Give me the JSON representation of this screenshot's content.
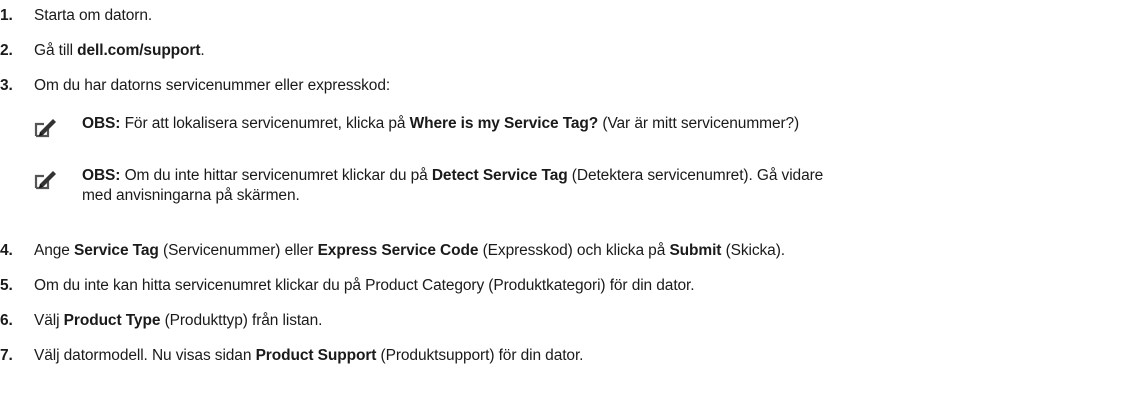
{
  "steps": [
    {
      "num": "1.",
      "parts": [
        {
          "t": "Starta om datorn.",
          "b": false
        }
      ]
    },
    {
      "num": "2.",
      "parts": [
        {
          "t": "Gå till ",
          "b": false
        },
        {
          "t": "dell.com/support",
          "b": true
        },
        {
          "t": ".",
          "b": false
        }
      ]
    },
    {
      "num": "3.",
      "parts": [
        {
          "t": "Om du har datorns servicenummer eller expresskod:",
          "b": false
        }
      ]
    },
    {
      "num": "4.",
      "parts": [
        {
          "t": "Ange ",
          "b": false
        },
        {
          "t": "Service Tag",
          "b": true
        },
        {
          "t": " (Servicenummer) eller ",
          "b": false
        },
        {
          "t": "Express Service Code",
          "b": true
        },
        {
          "t": " (Expresskod) och klicka på ",
          "b": false
        },
        {
          "t": "Submit",
          "b": true
        },
        {
          "t": " (Skicka).",
          "b": false
        }
      ]
    },
    {
      "num": "5.",
      "parts": [
        {
          "t": "Om du inte kan hitta servicenumret klickar du på Product Category (Produktkategori) för din dator.",
          "b": false
        }
      ]
    },
    {
      "num": "6.",
      "parts": [
        {
          "t": "Välj ",
          "b": false
        },
        {
          "t": "Product Type",
          "b": true
        },
        {
          "t": " (Produkttyp) från listan.",
          "b": false
        }
      ]
    },
    {
      "num": "7.",
      "parts": [
        {
          "t": "Välj datormodell. Nu visas sidan ",
          "b": false
        },
        {
          "t": "Product Support",
          "b": true
        },
        {
          "t": " (Produktsupport) för din dator.",
          "b": false
        }
      ]
    }
  ],
  "notes": [
    {
      "icon": "pencil-note-icon",
      "lines": [
        [
          {
            "t": "OBS:",
            "b": true
          },
          {
            "t": " För att lokalisera servicenumret, klicka på ",
            "b": false
          },
          {
            "t": "Where is my Service Tag?",
            "b": true
          },
          {
            "t": " (Var är mitt servicenummer?)",
            "b": false
          }
        ]
      ]
    },
    {
      "icon": "pencil-note-icon",
      "lines": [
        [
          {
            "t": "OBS:",
            "b": true
          },
          {
            "t": " Om du inte hittar servicenumret klickar du på ",
            "b": false
          },
          {
            "t": "Detect Service Tag",
            "b": true
          },
          {
            "t": " (Detektera servicenumret). Gå vidare",
            "b": false
          }
        ],
        [
          {
            "t": "med anvisningarna på skärmen.",
            "b": false
          }
        ]
      ]
    }
  ]
}
